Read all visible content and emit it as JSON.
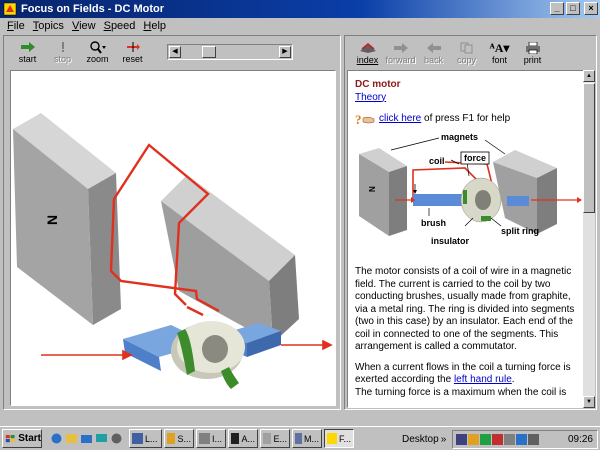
{
  "window": {
    "title": "Focus on Fields - DC Motor"
  },
  "menu": [
    "File",
    "Topics",
    "View",
    "Speed",
    "Help"
  ],
  "left_toolbar": [
    {
      "label": "start",
      "icon": "start-arrow-icon",
      "enabled": true
    },
    {
      "label": "stop",
      "icon": "stop-icon",
      "enabled": false
    },
    {
      "label": "zoom",
      "icon": "zoom-icon",
      "enabled": true
    },
    {
      "label": "reset",
      "icon": "reset-icon",
      "enabled": true
    }
  ],
  "speed_slider": {
    "value": 0.25
  },
  "right_toolbar": [
    {
      "label": "index",
      "icon": "index-icon",
      "enabled": true
    },
    {
      "label": "forward",
      "icon": "forward-icon",
      "enabled": false
    },
    {
      "label": "back",
      "icon": "back-icon",
      "enabled": false
    },
    {
      "label": "copy",
      "icon": "copy-icon",
      "enabled": false
    },
    {
      "label": "font",
      "icon": "font-icon",
      "enabled": true
    },
    {
      "label": "print",
      "icon": "print-icon",
      "enabled": true
    }
  ],
  "content": {
    "heading": "DC motor",
    "theory_link": "Theory",
    "help_link": "click here",
    "help_text": " of press F1 for help",
    "diagram_labels": {
      "magnets": "magnets",
      "coil": "coil",
      "force": "force",
      "brush": "brush",
      "split_ring": "split ring",
      "insulator": "insulator",
      "n_pole": "N"
    },
    "para1": "The motor consists of a coil of wire in a magnetic field. The current is carried to the coil by two conducting brushes, usually made from graphite, via a metal ring. The ring is divided into segments (two in this case) by an insulator. Each end of the coil in connected to one of the segments. This arrangement is called a commutator.",
    "para2_before": "When a current flows in the coil a turning force is exerted according the ",
    "para2_link": "left hand rule",
    "para2_after": ".",
    "para3": "The turning force is a maximum when the coil is"
  },
  "simulation": {
    "magnet_label": "N"
  },
  "taskbar": {
    "start_label": "Start",
    "buttons": [
      {
        "label": "L...",
        "active": false
      },
      {
        "label": "S...",
        "active": false
      },
      {
        "label": "I...",
        "active": false
      },
      {
        "label": "A...",
        "active": false
      },
      {
        "label": "E...",
        "active": false
      },
      {
        "label": "M...",
        "active": false
      },
      {
        "label": "F...",
        "active": true
      }
    ],
    "desktop_label": "Desktop",
    "clock": "09:26"
  },
  "colors": {
    "title_start": "#08246b",
    "title_end": "#a6caf0",
    "link": "#0000cc",
    "heading": "#8b1a1a",
    "wire": "#e0301e",
    "shaft": "#4f7fc8",
    "insulator": "#3c8c2c"
  }
}
